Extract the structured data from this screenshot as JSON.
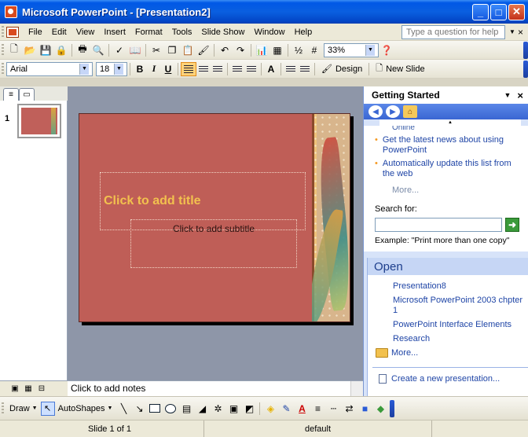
{
  "window": {
    "title": "Microsoft PowerPoint - [Presentation2]",
    "min_label": "_",
    "max_label": "□",
    "close_label": "✕"
  },
  "menu": {
    "items": [
      {
        "label": "File"
      },
      {
        "label": "Edit"
      },
      {
        "label": "View"
      },
      {
        "label": "Insert"
      },
      {
        "label": "Format"
      },
      {
        "label": "Tools"
      },
      {
        "label": "Slide Show"
      },
      {
        "label": "Window"
      },
      {
        "label": "Help"
      }
    ],
    "ask_placeholder": "Type a question for help",
    "close_label": "×"
  },
  "standard_toolbar": {
    "zoom_value": "33%"
  },
  "formatting_toolbar": {
    "font_name": "Arial",
    "font_size": "18",
    "bold_label": "B",
    "italic_label": "I",
    "underline_label": "U",
    "font_bigger_label": "A",
    "design_label": "Design",
    "new_slide_label": "New Slide"
  },
  "slides_pane": {
    "slide_number": "1"
  },
  "slide": {
    "title_placeholder": "Click to add title",
    "subtitle_placeholder": "Click to add subtitle",
    "background_color": "#bf5e57"
  },
  "notes": {
    "placeholder": "Click to add notes"
  },
  "task_pane": {
    "title": "Getting Started",
    "clipped_text": "Online",
    "links": [
      {
        "label": "Get the latest news about using PowerPoint"
      },
      {
        "label": "Automatically update this list from the web"
      }
    ],
    "more_label": "More...",
    "search_label": "Search for:",
    "search_value": "",
    "example_text": "Example: \"Print more than one copy\"",
    "open_heading": "Open",
    "open_items": [
      {
        "label": "Presentation8"
      },
      {
        "label": "Microsoft PowerPoint 2003 chpter 1"
      },
      {
        "label": "PowerPoint Interface Elements"
      },
      {
        "label": "Research"
      }
    ],
    "open_more_label": "More...",
    "create_label": "Create a new presentation..."
  },
  "drawing_toolbar": {
    "draw_label": "Draw",
    "autoshapes_label": "AutoShapes"
  },
  "status_bar": {
    "slide_position": "Slide 1 of 1",
    "design_name": "default"
  }
}
